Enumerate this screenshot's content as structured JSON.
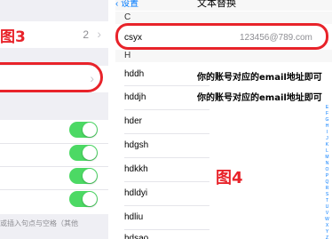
{
  "left": {
    "figure_label": "图3",
    "row_count": "2",
    "footnote": "或插入句点与空格（其他"
  },
  "right": {
    "nav": {
      "back_label": "‹ 设置",
      "title": "文本替换"
    },
    "sections": [
      {
        "header": "C"
      },
      {
        "header": "H"
      }
    ],
    "highlighted_contact": {
      "name": "csyx",
      "email": "123456@789.com"
    },
    "contacts_h": [
      "hddh",
      "hddjh",
      "hder",
      "hdgsh",
      "hdkkh",
      "hdldyi",
      "hdliu",
      "hdsao"
    ],
    "notes": [
      "你的账号对应的email地址即可",
      "你的账号对应的email地址即可"
    ],
    "figure_label": "图4",
    "index_letters": [
      "E",
      "F",
      "G",
      "H",
      "I",
      "J",
      "K",
      "L",
      "M",
      "N",
      "O",
      "P",
      "Q",
      "R",
      "S",
      "T",
      "U",
      "V",
      "W",
      "X",
      "Y",
      "Z",
      "#"
    ]
  },
  "colors": {
    "annotation_red": "#e8232a",
    "toggle_green": "#4cd964",
    "ios_blue": "#007aff",
    "grouped_bg": "#efeff4"
  }
}
